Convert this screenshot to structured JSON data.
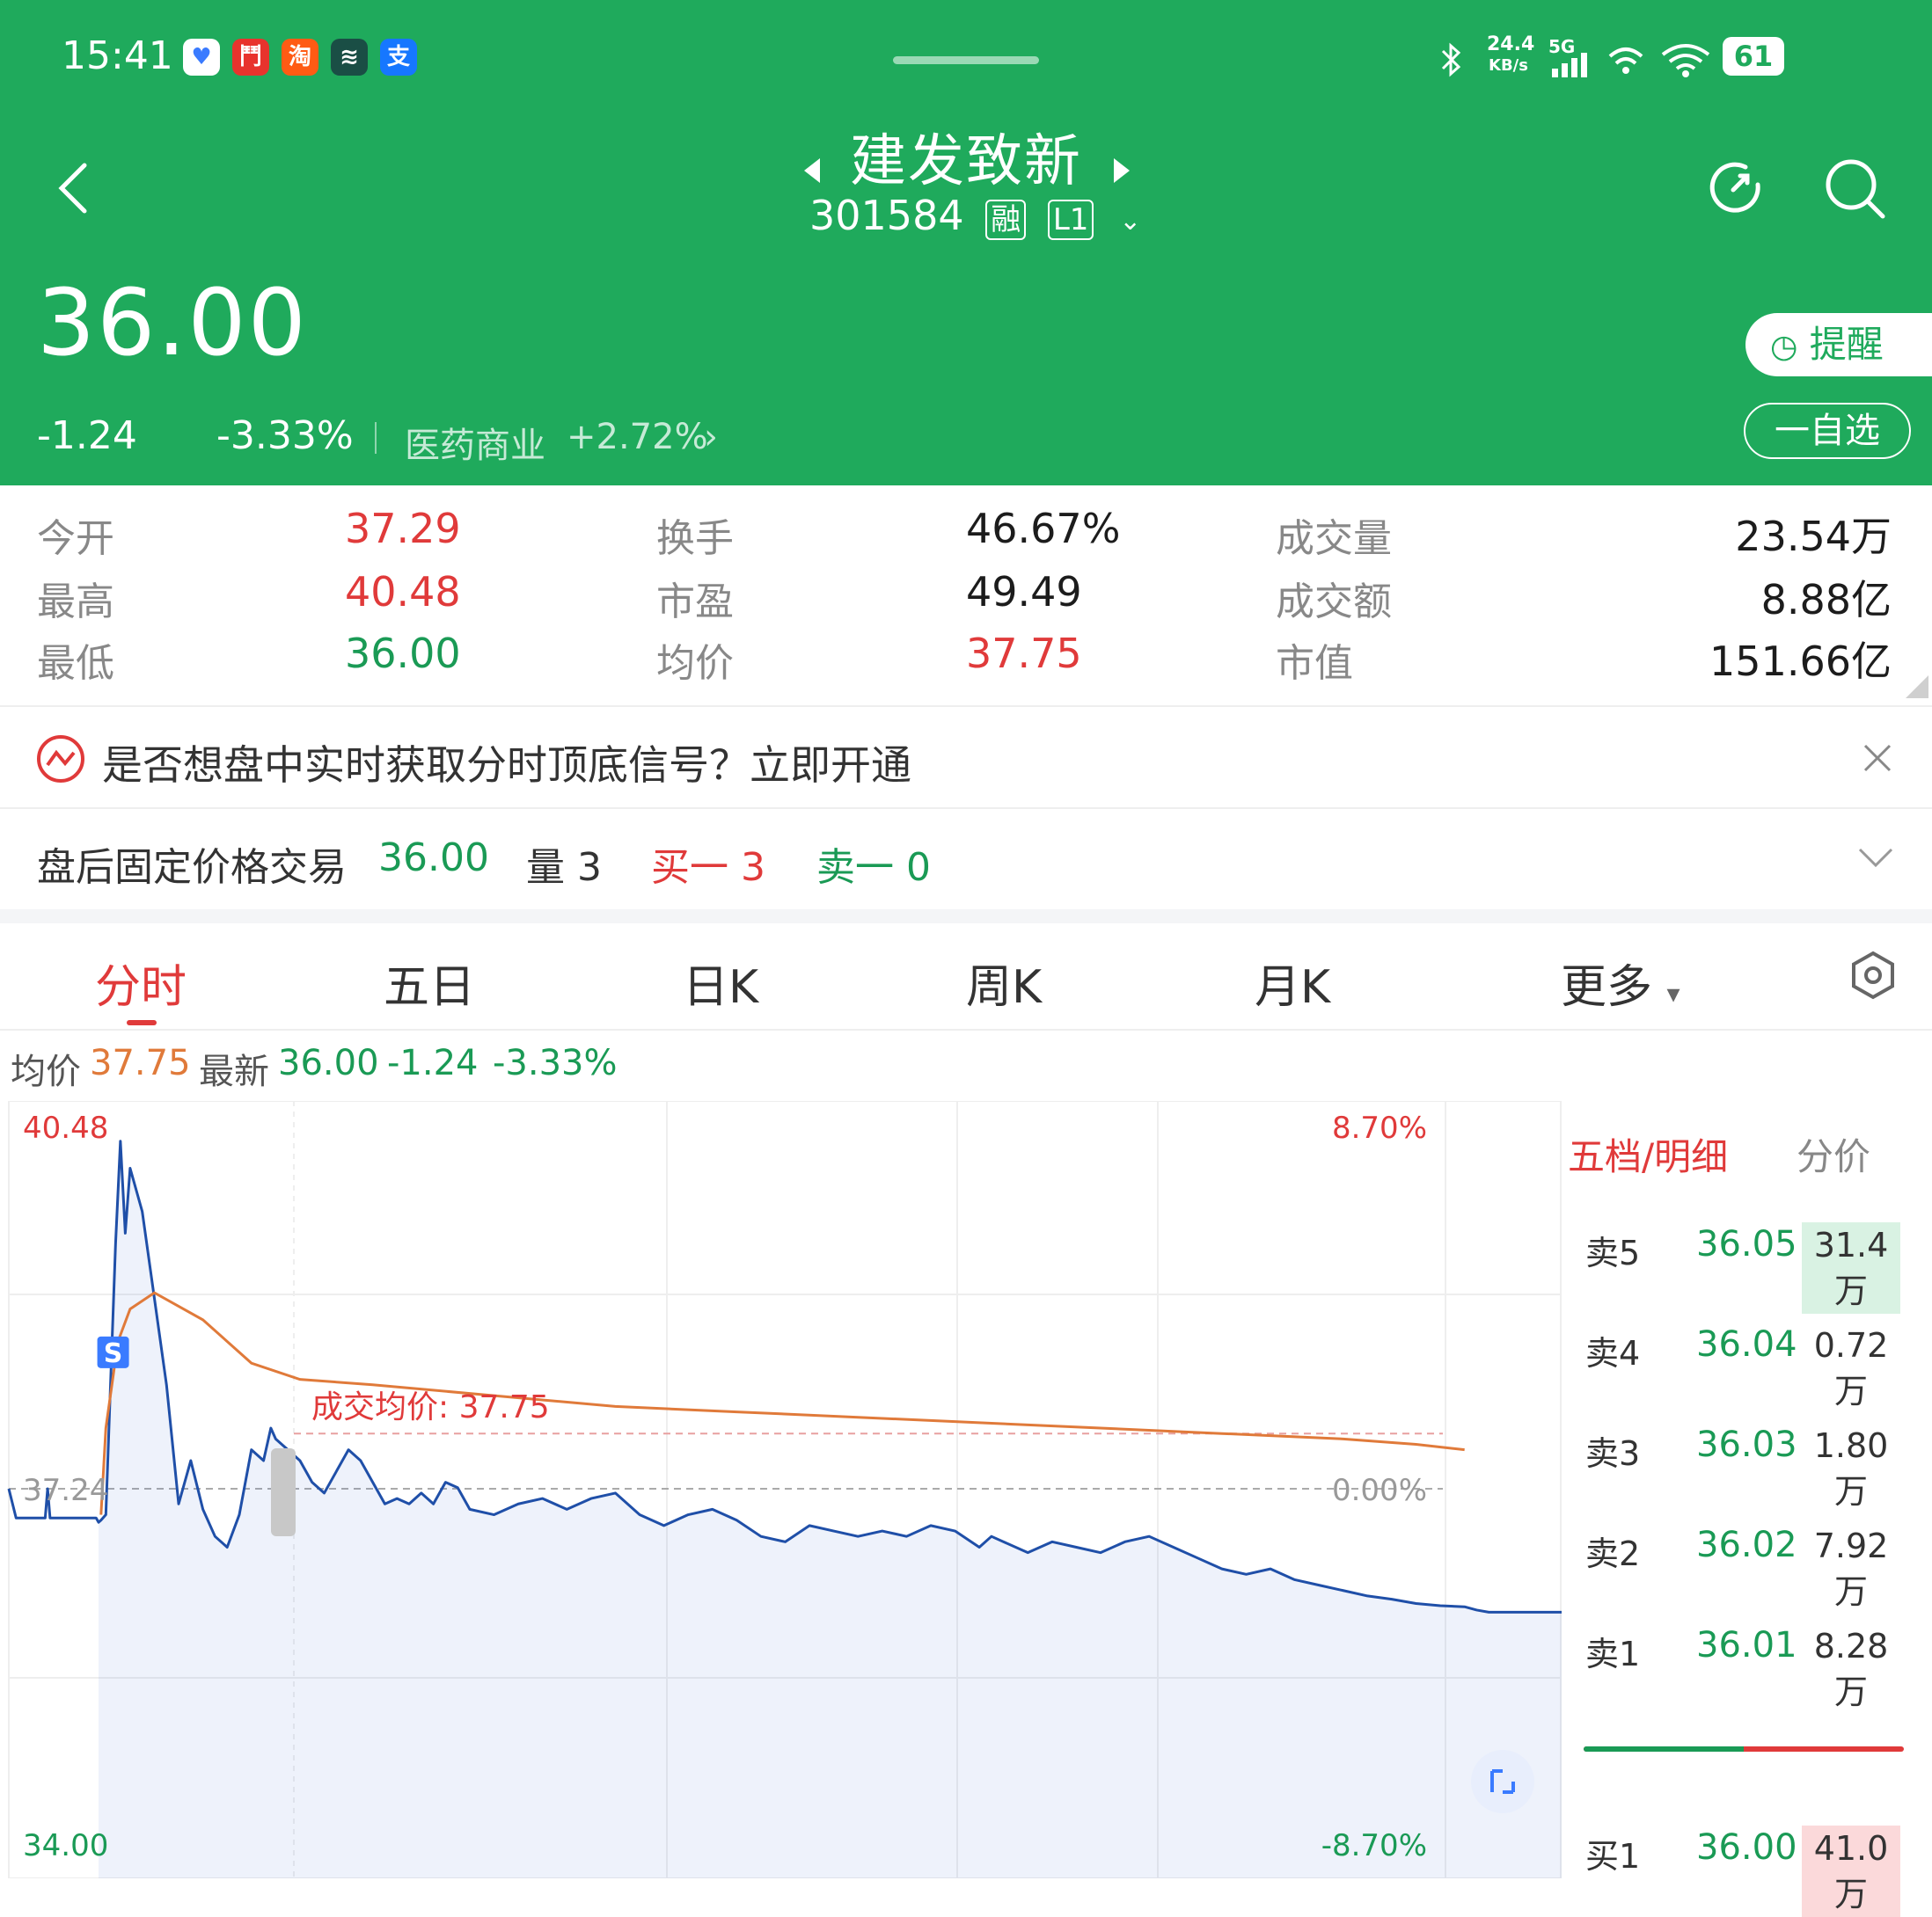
{
  "status_bar": {
    "time": "15:41",
    "apps": [
      {
        "icon": "heart-app-icon",
        "glyph": "♥",
        "color": "#ffffff",
        "fg": "#3a7bff"
      },
      {
        "icon": "game-app-icon",
        "glyph": "鬥",
        "color": "#e8332d",
        "fg": "#ffffff"
      },
      {
        "icon": "taobao-app-icon",
        "glyph": "淘",
        "color": "#ff5b14",
        "fg": "#ffffff"
      },
      {
        "icon": "trading-app-icon",
        "glyph": "≋",
        "color": "#1a4e45",
        "fg": "#ffffff"
      },
      {
        "icon": "alipay-app-icon",
        "glyph": "支",
        "color": "#1677ff",
        "fg": "#ffffff"
      }
    ],
    "net_speed": "24.4",
    "net_unit": "KB/s",
    "net_type": "5G",
    "battery": "61"
  },
  "header": {
    "title": "建发致新",
    "code": "301584",
    "badge_margin": "融",
    "badge_level": "L1",
    "price": "36.00",
    "change": "-1.24",
    "change_pct": "-3.33%",
    "sector": "医药商业",
    "sector_change": "+2.72%",
    "remind_label": "提醒",
    "watch_label": "一自选"
  },
  "stats": [
    {
      "label": "今开",
      "value": "37.29",
      "tone": "red"
    },
    {
      "label": "最高",
      "value": "40.48",
      "tone": "red"
    },
    {
      "label": "最低",
      "value": "36.00",
      "tone": "green"
    },
    {
      "label": "换手",
      "value": "46.67%",
      "tone": "dark"
    },
    {
      "label": "市盈",
      "value": "49.49",
      "tone": "dark"
    },
    {
      "label": "均价",
      "value": "37.75",
      "tone": "red"
    },
    {
      "label": "成交量",
      "value": "23.54万",
      "tone": "dark"
    },
    {
      "label": "成交额",
      "value": "8.88亿",
      "tone": "dark"
    },
    {
      "label": "市值",
      "value": "151.66亿",
      "tone": "dark"
    }
  ],
  "banner": {
    "text": "是否想盘中实时获取分时顶底信号？立即开通"
  },
  "after_hours": {
    "label": "盘后固定价格交易",
    "price": "36.00",
    "volume_label": "量 3",
    "bid_label": "买一 3",
    "ask_label": "卖一 0"
  },
  "tabs": [
    "分时",
    "五日",
    "日K",
    "周K",
    "月K",
    "更多"
  ],
  "chart_info": {
    "avg_label": "均价",
    "avg_value": "37.75",
    "last_label": "最新",
    "last_value": "36.00",
    "change": "-1.24",
    "change_pct": "-3.33%"
  },
  "chart_data": {
    "type": "line",
    "y_max_label": "40.48",
    "y_min_label": "34.00",
    "ref_label": "37.24",
    "pct_max_label": "8.70%",
    "pct_min_label": "-8.70%",
    "pct_zero_label": "0.00%",
    "avg_price_annotation": "成交均价: 37.75",
    "signal_marker": "S",
    "ylim": [
      34.0,
      40.48
    ],
    "prev_close": 37.24,
    "avg_line_value": 37.75,
    "series": [
      {
        "kind": "price",
        "color": "#1f4fa8",
        "x": [
          0,
          0.03,
          0.08,
          0.12,
          0.15,
          0.16,
          0.17,
          0.22,
          0.3,
          0.36,
          0.37,
          0.38,
          0.4,
          0.44,
          0.46,
          0.48,
          0.5,
          0.55,
          0.6,
          0.65,
          0.7,
          0.75,
          0.8,
          0.85,
          0.9,
          0.95,
          1.0,
          1.05,
          1.08,
          1.1,
          1.15,
          1.2,
          1.25,
          1.3,
          1.35,
          1.4,
          1.45,
          1.5,
          1.55,
          1.6,
          1.65,
          1.7,
          1.75,
          1.8,
          1.85,
          1.9,
          2.0,
          2.1,
          2.2,
          2.3,
          2.4,
          2.5,
          2.6,
          2.7,
          2.8,
          2.9,
          3.0,
          3.1,
          3.2,
          3.3,
          3.4,
          3.5,
          3.6,
          3.7,
          3.8,
          3.9,
          4.0,
          4.05,
          4.1,
          4.2,
          4.3,
          4.4,
          4.5,
          4.6,
          4.7,
          4.8,
          4.9,
          5.0,
          5.1,
          5.2,
          5.3,
          5.4,
          5.5,
          5.6,
          5.7,
          5.8,
          5.9,
          6.0,
          6.05,
          6.1,
          6.2,
          6.3,
          6.4
        ],
        "values": [
          37.24,
          36.97,
          36.97,
          36.97,
          36.97,
          37.24,
          36.97,
          36.97,
          36.97,
          36.97,
          36.93,
          36.95,
          37.0,
          39.5,
          40.45,
          39.6,
          40.2,
          39.8,
          39.0,
          38.2,
          37.1,
          37.5,
          37.05,
          36.8,
          36.7,
          37.0,
          37.6,
          37.5,
          37.8,
          37.7,
          37.6,
          37.5,
          37.3,
          37.2,
          37.4,
          37.6,
          37.5,
          37.3,
          37.1,
          37.15,
          37.1,
          37.2,
          37.1,
          37.3,
          37.25,
          37.05,
          37.0,
          37.1,
          37.15,
          37.05,
          37.15,
          37.2,
          37.0,
          36.9,
          37.0,
          37.05,
          36.95,
          36.8,
          36.75,
          36.9,
          36.85,
          36.8,
          36.85,
          36.8,
          36.9,
          36.85,
          36.7,
          36.8,
          36.75,
          36.65,
          36.75,
          36.7,
          36.65,
          36.75,
          36.8,
          36.7,
          36.6,
          36.5,
          36.45,
          36.5,
          36.4,
          36.35,
          36.3,
          36.25,
          36.22,
          36.18,
          36.16,
          36.15,
          36.12,
          36.1,
          36.1,
          36.1,
          36.1
        ]
      },
      {
        "kind": "average",
        "color": "#e07a3a",
        "x": [
          0.38,
          0.4,
          0.45,
          0.5,
          0.6,
          0.8,
          1.0,
          1.2,
          1.5,
          2.0,
          2.5,
          3.0,
          3.5,
          4.0,
          4.5,
          5.0,
          5.5,
          5.8,
          6.0
        ],
        "values": [
          37.0,
          37.8,
          38.6,
          38.9,
          39.05,
          38.8,
          38.4,
          38.25,
          38.2,
          38.1,
          38.0,
          37.95,
          37.9,
          37.85,
          37.8,
          37.75,
          37.7,
          37.65,
          37.6
        ]
      }
    ],
    "grid": true
  },
  "orderbook": {
    "tab_active": "五档/明细",
    "tab_other": "分价",
    "asks": [
      {
        "label": "卖5",
        "price": "36.05",
        "volume": "31.4万",
        "highlight": "green"
      },
      {
        "label": "卖4",
        "price": "36.04",
        "volume": "0.72万",
        "highlight": ""
      },
      {
        "label": "卖3",
        "price": "36.03",
        "volume": "1.80万",
        "highlight": ""
      },
      {
        "label": "卖2",
        "price": "36.02",
        "volume": "7.92万",
        "highlight": ""
      },
      {
        "label": "卖1",
        "price": "36.01",
        "volume": "8.28万",
        "highlight": ""
      }
    ],
    "bids": [
      {
        "label": "买1",
        "price": "36.00",
        "volume": "41.0万",
        "highlight": "red"
      }
    ],
    "ratio_buy": 0.5
  }
}
